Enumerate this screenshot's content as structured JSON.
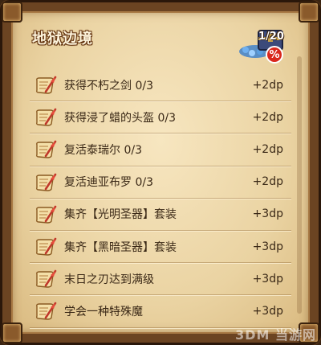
{
  "panel": {
    "title": "地狱边境",
    "progress": "1/20",
    "badge": "%"
  },
  "achievements": [
    {
      "label": "获得不朽之剑 0/3",
      "reward": "+2dp"
    },
    {
      "label": "获得浸了蜡的头盔 0/3",
      "reward": "+2dp"
    },
    {
      "label": "复活泰瑞尔 0/3",
      "reward": "+2dp"
    },
    {
      "label": "复活迪亚布罗 0/3",
      "reward": "+2dp"
    },
    {
      "label": "集齐【光明圣器】套装",
      "reward": "+3dp"
    },
    {
      "label": "集齐【黑暗圣器】套装",
      "reward": "+3dp"
    },
    {
      "label": "末日之刃达到满级",
      "reward": "+3dp"
    },
    {
      "label": "学会一种特殊魔",
      "reward": "+3dp"
    }
  ],
  "icons": {
    "row_icon": "scroll-quill-icon",
    "header_icon": "treasure-chest-icon"
  },
  "watermark": "3DM 当游网"
}
